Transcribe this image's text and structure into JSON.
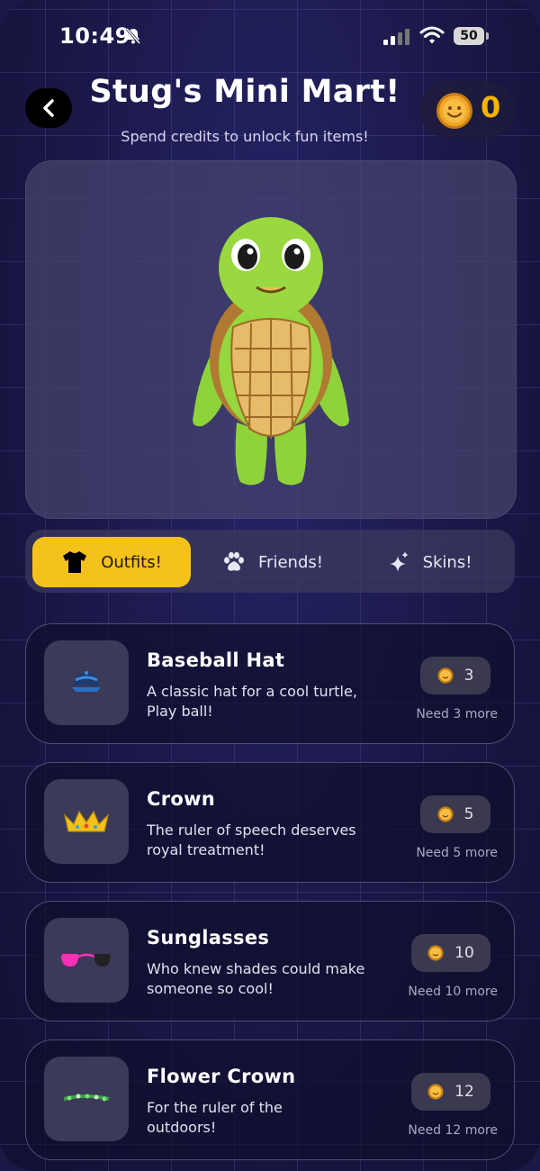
{
  "status_bar": {
    "time": "10:49",
    "battery": "50",
    "icons": [
      "bell-slash-icon",
      "signal-icon",
      "wifi-icon",
      "battery-icon"
    ]
  },
  "header": {
    "back_icon": "chevron-left-icon",
    "title": "Stug's Mini Mart!",
    "subtitle": "Spend credits to unlock fun items!",
    "credits": "0",
    "credit_icon": "coin-icon"
  },
  "preview": {
    "character_icon": "turtle-character-icon"
  },
  "tabs": [
    {
      "label": "Outfits!",
      "icon": "tshirt-icon",
      "active": true
    },
    {
      "label": "Friends!",
      "icon": "paw-icon",
      "active": false
    },
    {
      "label": "Skins!",
      "icon": "sparkles-icon",
      "active": false
    }
  ],
  "items": [
    {
      "name": "Baseball Hat",
      "description": "A classic hat for a cool turtle, Play ball!",
      "price": "3",
      "need": "Need 3 more",
      "icon": "baseball-hat-icon"
    },
    {
      "name": "Crown",
      "description": "The ruler of speech deserves royal treatment!",
      "price": "5",
      "need": "Need 5 more",
      "icon": "crown-icon"
    },
    {
      "name": "Sunglasses",
      "description": "Who knew shades could make someone so cool!",
      "price": "10",
      "need": "Need 10 more",
      "icon": "sunglasses-icon"
    },
    {
      "name": "Flower Crown",
      "description": "For the ruler of the outdoors!",
      "price": "12",
      "need": "Need 12 more",
      "icon": "flower-crown-icon"
    }
  ],
  "colors": {
    "accent": "#f5c21b",
    "coin": "#f4b400",
    "background": "#17163f"
  }
}
